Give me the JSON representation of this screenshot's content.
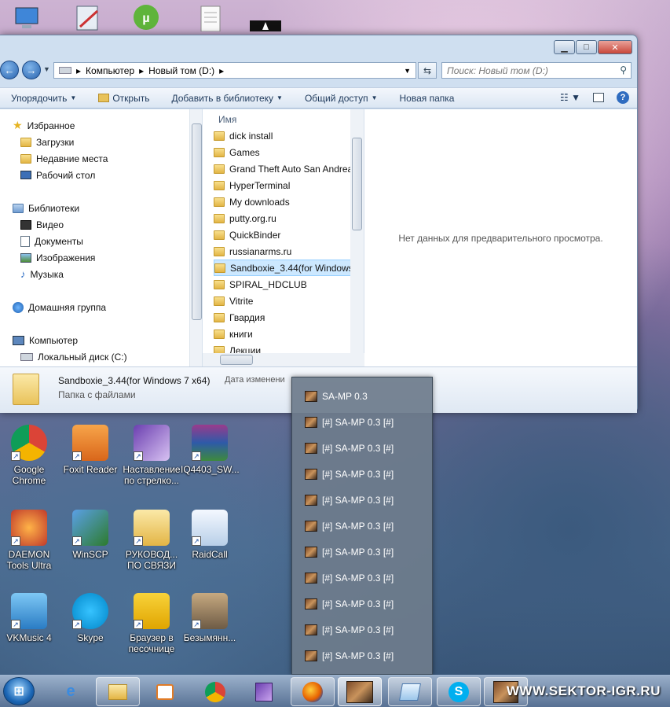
{
  "explorer": {
    "breadcrumb": [
      "Компьютер",
      "Новый том (D:)"
    ],
    "search_placeholder": "Поиск: Новый том (D:)",
    "toolbar": {
      "organize": "Упорядочить",
      "open": "Открыть",
      "add_to_library": "Добавить в библиотеку",
      "share": "Общий доступ",
      "new_folder": "Новая папка"
    },
    "nav": {
      "favorites": "Избранное",
      "downloads": "Загрузки",
      "recent": "Недавние места",
      "desktop": "Рабочий стол",
      "libraries": "Библиотеки",
      "video": "Видео",
      "documents": "Документы",
      "images": "Изображения",
      "music": "Музыка",
      "homegroup": "Домашняя группа",
      "computer": "Компьютер",
      "local_disk": "Локальный диск (C:)"
    },
    "column_name": "Имя",
    "files": [
      "dick install",
      "Games",
      "Grand Theft Auto San Andreas",
      "HyperTerminal",
      "My downloads",
      "putty.org.ru",
      "QuickBinder",
      "russianarms.ru",
      "Sandboxie_3.44(for Windows 7 x64)",
      "SPIRAL_HDCLUB",
      "Vitrite",
      "Гвардия",
      "книги",
      "Лекции"
    ],
    "selected_index": 8,
    "preview_text": "Нет данных для предварительного просмотра.",
    "details": {
      "name": "Sandboxie_3.44(for Windows 7 x64)",
      "date_label": "Дата изменени",
      "type": "Папка с файлами"
    }
  },
  "jumplist": {
    "items": [
      "SA-MP 0.3",
      "[#] SA-MP 0.3 [#]",
      "[#] SA-MP 0.3 [#]",
      "[#] SA-MP 0.3 [#]",
      "[#] SA-MP 0.3 [#]",
      "[#] SA-MP 0.3 [#]",
      "[#] SA-MP 0.3 [#]",
      "[#] SA-MP 0.3 [#]",
      "[#] SA-MP 0.3 [#]",
      "[#] SA-MP 0.3 [#]",
      "[#] SA-MP 0.3 [#]"
    ]
  },
  "desktop": {
    "icons": [
      {
        "label": "Google Chrome",
        "icon": "chrome-icon"
      },
      {
        "label": "Foxit Reader",
        "icon": "pdf-icon"
      },
      {
        "label": "Наставление по стрелко...",
        "icon": "document-icon"
      },
      {
        "label": "IQ4403_SW...",
        "icon": "archive-icon"
      },
      {
        "label": "DAEMON Tools Ultra",
        "icon": "daemon-icon"
      },
      {
        "label": "WinSCP",
        "icon": "winscp-icon"
      },
      {
        "label": "РУКОВОД... ПО СВЯЗИ",
        "icon": "folder-icon"
      },
      {
        "label": "RaidCall",
        "icon": "raidcall-icon"
      },
      {
        "label": "VKMusic 4",
        "icon": "music-icon"
      },
      {
        "label": "Skype",
        "icon": "skype-icon"
      },
      {
        "label": "Браузер в песочнице",
        "icon": "sandbox-icon"
      },
      {
        "label": "Безымянн...",
        "icon": "image-icon"
      }
    ]
  },
  "watermark": "WWW.SEKTOR-IGR.RU"
}
